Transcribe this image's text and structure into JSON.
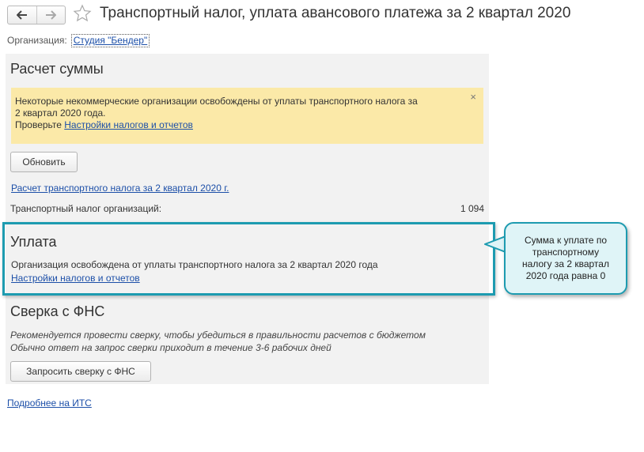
{
  "header": {
    "back_icon": "arrow-left-icon",
    "forward_icon": "arrow-right-icon",
    "favorite_icon": "star-icon",
    "title": "Транспортный налог, уплата авансового платежа за 2 квартал 2020"
  },
  "organization": {
    "label": "Организация:",
    "value": "Студия \"Бендер\""
  },
  "calc": {
    "title": "Расчет суммы",
    "warning": {
      "line1": "Некоторые некоммерческие организации освобождены от уплаты транспортного налога за",
      "line2": "2 квартал 2020 года.",
      "check_prefix": "Проверьте",
      "check_link": "Настройки налогов и отчетов",
      "close": "×"
    },
    "refresh_button": "Обновить",
    "calc_link": "Расчет транспортного налога за 2 квартал 2020 г.",
    "tax_label": "Транспортный налог организаций:",
    "tax_value": "1 094"
  },
  "payment": {
    "title": "Уплата",
    "text": "Организация освобождена от уплаты транспортного налога за 2 квартал 2020 года",
    "settings_link": "Настройки налогов и отчетов"
  },
  "reconciliation": {
    "title": "Сверка с ФНС",
    "line1": "Рекомендуется провести сверку, чтобы убедиться в правильности расчетов с бюджетом",
    "line2": "Обычно ответ на запрос сверки приходит в течение 3-6 рабочих дней",
    "request_button": "Запросить сверку с ФНС"
  },
  "footer": {
    "its_link": "Подробнее на ИТС"
  },
  "callout": {
    "line1": "Сумма к уплате по",
    "line2": "транспортному",
    "line3": "налогу за 2 квартал",
    "line4": "2020 года равна 0"
  },
  "colors": {
    "accent": "#1d9bb0",
    "warning_bg": "#fbe9a8",
    "panel_bg": "#f2f2f2",
    "link": "#1c4fa8"
  }
}
